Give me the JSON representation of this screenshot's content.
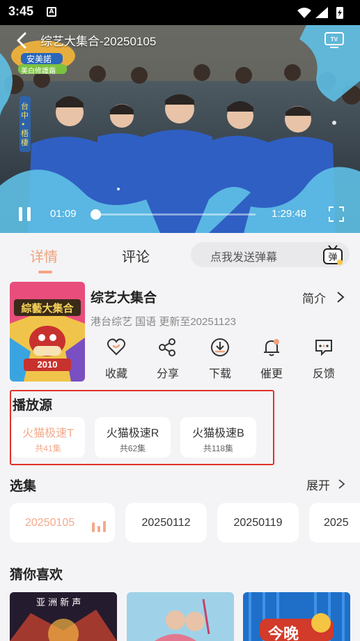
{
  "status_bar": {
    "time": "3:45",
    "notification_icon": "A"
  },
  "player": {
    "title": "综艺大集合-20250105",
    "current_time": "01:09",
    "total_time": "1:29:48",
    "progress_fraction": 0.013,
    "overlay_logo": {
      "badge_text": "安美諾",
      "badge_sub": "美白修護霜",
      "side_text": "台中•梧棲"
    }
  },
  "tabs": {
    "detail": "详情",
    "comment": "评论"
  },
  "danmaku": {
    "placeholder": "点我发送弹幕",
    "icon_char": "弹"
  },
  "show": {
    "title": "综艺大集合",
    "meta": "港台综艺 国语 更新至20251123",
    "intro_label": "简介",
    "poster_text": "綜藝大集合",
    "poster_year": "2010"
  },
  "actions": [
    {
      "label": "收藏",
      "icon": "heart-icon"
    },
    {
      "label": "分享",
      "icon": "share-icon"
    },
    {
      "label": "下载",
      "icon": "download-icon"
    },
    {
      "label": "催更",
      "icon": "bell-icon"
    },
    {
      "label": "反馈",
      "icon": "feedback-icon"
    }
  ],
  "sources": {
    "title": "播放源",
    "items": [
      {
        "name": "火猫极速T",
        "count": "共41集",
        "active": true
      },
      {
        "name": "火猫极速R",
        "count": "共62集",
        "active": false
      },
      {
        "name": "火猫极速B",
        "count": "共118集",
        "active": false
      }
    ]
  },
  "episodes": {
    "title": "选集",
    "expand_label": "展开",
    "items": [
      "20250105",
      "20250112",
      "20250119",
      "2025"
    ]
  },
  "recommend": {
    "title": "猜你喜欢",
    "items": [
      {
        "caption": "亚 洲 新 声"
      },
      {
        "caption": ""
      },
      {
        "caption": "今晚"
      }
    ]
  },
  "colors": {
    "accent": "#f4a98a",
    "highlight_box": "#e2322b"
  }
}
